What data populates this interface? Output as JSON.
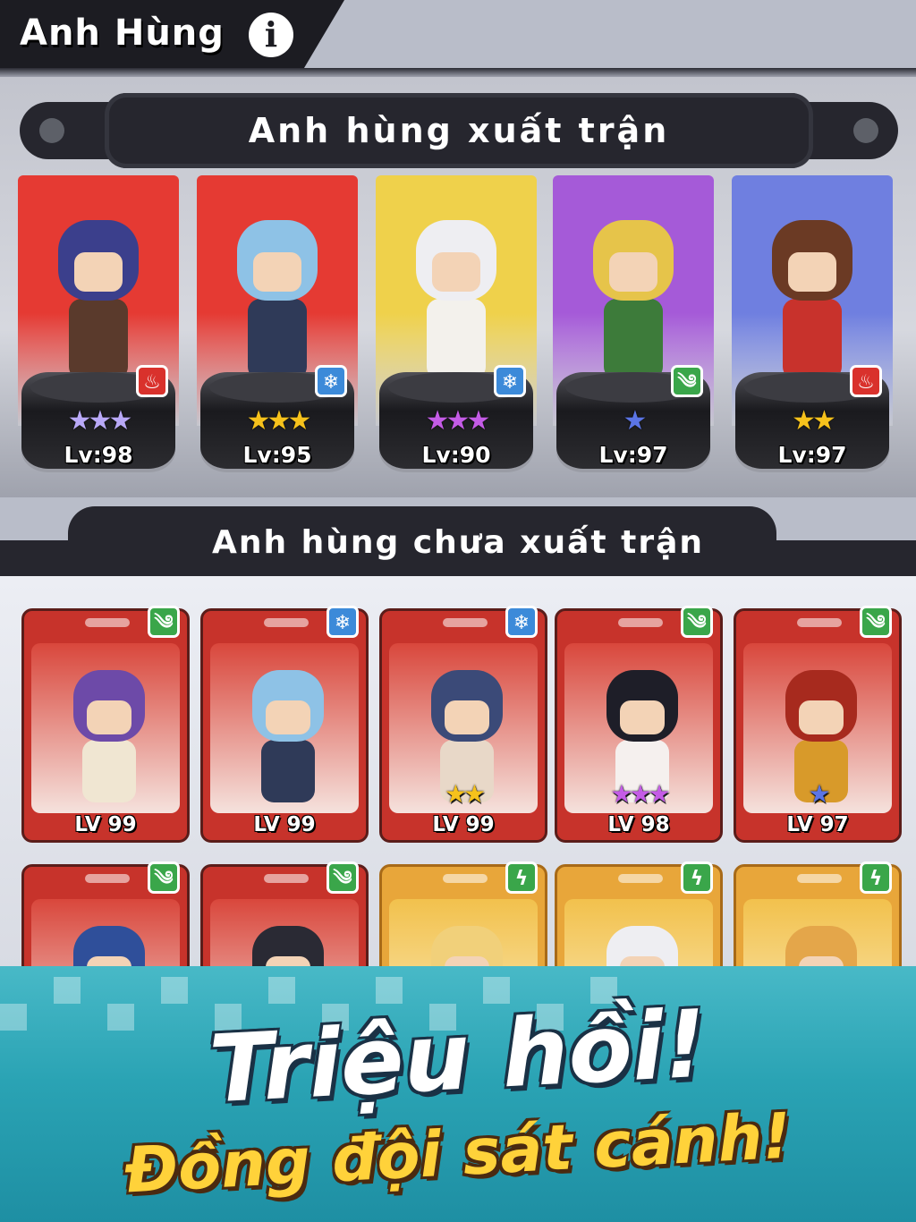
{
  "header": {
    "title": "Anh Hùng",
    "info_icon": "i"
  },
  "deployed": {
    "title": "Anh hùng xuất trận",
    "heroes": [
      {
        "level": "Lv:98",
        "stars": "★★★",
        "star_color": "#b9a9f7",
        "element": "fire",
        "element_glyph": "♨",
        "element_color": "#d9312c",
        "bg": "#e53a33",
        "hair": "#3b3f8c",
        "body": "#5a3a2c"
      },
      {
        "level": "Lv:95",
        "stars": "★★★",
        "star_color": "#f6c21c",
        "element": "ice",
        "element_glyph": "❄",
        "element_color": "#3c8ad9",
        "bg": "#e53a33",
        "hair": "#8ec2e6",
        "body": "#2f3a58"
      },
      {
        "level": "Lv:90",
        "stars": "★★★",
        "star_color": "#c45ce6",
        "element": "ice",
        "element_glyph": "❄",
        "element_color": "#3c8ad9",
        "bg": "#efd14b",
        "hair": "#eeeef2",
        "body": "#f3f1ec"
      },
      {
        "level": "Lv:97",
        "stars": "★",
        "star_color": "#5b75e6",
        "element": "wind",
        "element_glyph": "༄",
        "element_color": "#3aa64a",
        "bg": "#a55ad8",
        "hair": "#e6c44a",
        "body": "#3d7b3a"
      },
      {
        "level": "Lv:97",
        "stars": "★★",
        "star_color": "#f6c21c",
        "element": "fire",
        "element_glyph": "♨",
        "element_color": "#d9312c",
        "bg": "#6f7fe0",
        "hair": "#6b3a24",
        "body": "#c8322c"
      }
    ]
  },
  "reserve": {
    "title": "Anh hùng chưa xuất trận",
    "cards": [
      {
        "level": "LV 99",
        "stars": "",
        "star_color": "#ffffff",
        "element": "wind",
        "element_glyph": "༄",
        "element_color": "#3aa64a",
        "style": "red",
        "head": "#6d4aa8",
        "body": "#f0e6d2"
      },
      {
        "level": "LV 99",
        "stars": "",
        "star_color": "#ffffff",
        "element": "ice",
        "element_glyph": "❄",
        "element_color": "#3c8ad9",
        "style": "red",
        "head": "#8ec2e6",
        "body": "#2f3a58"
      },
      {
        "level": "LV 99",
        "stars": "★★",
        "star_color": "#f6c21c",
        "element": "ice",
        "element_glyph": "❄",
        "element_color": "#3c8ad9",
        "style": "red",
        "head": "#3b4a78",
        "body": "#e8d8c8"
      },
      {
        "level": "LV 98",
        "stars": "★★★",
        "star_color": "#c45ce6",
        "element": "wind",
        "element_glyph": "༄",
        "element_color": "#3aa64a",
        "style": "red",
        "head": "#1e1e28",
        "body": "#f5f0ee"
      },
      {
        "level": "LV 97",
        "stars": "★",
        "star_color": "#5b75e6",
        "element": "wind",
        "element_glyph": "༄",
        "element_color": "#3aa64a",
        "style": "red",
        "head": "#a72a1e",
        "body": "#d89a2a"
      },
      {
        "level": "",
        "stars": "",
        "star_color": "#ffffff",
        "element": "wind",
        "element_glyph": "༄",
        "element_color": "#3aa64a",
        "style": "red",
        "head": "#2f4f9a",
        "body": "#e6b53a"
      },
      {
        "level": "",
        "stars": "",
        "star_color": "#ffffff",
        "element": "wind",
        "element_glyph": "༄",
        "element_color": "#3aa64a",
        "style": "red",
        "head": "#2a2a34",
        "body": "#4a3a5a"
      },
      {
        "level": "",
        "stars": "",
        "star_color": "#ffffff",
        "element": "lightning",
        "element_glyph": "ϟ",
        "element_color": "#3aa64a",
        "style": "gold",
        "head": "#f1d07a",
        "body": "#e7c46a"
      },
      {
        "level": "",
        "stars": "",
        "star_color": "#ffffff",
        "element": "lightning",
        "element_glyph": "ϟ",
        "element_color": "#3aa64a",
        "style": "gold",
        "head": "#eeeef2",
        "body": "#e7c46a"
      },
      {
        "level": "",
        "stars": "",
        "star_color": "#ffffff",
        "element": "lightning",
        "element_glyph": "ϟ",
        "element_color": "#3aa64a",
        "style": "gold",
        "head": "#e4a64a",
        "body": "#e7c46a"
      }
    ]
  },
  "promo": {
    "title": "Triệu hồi!",
    "subtitle": "Đồng đội sát cánh!"
  }
}
